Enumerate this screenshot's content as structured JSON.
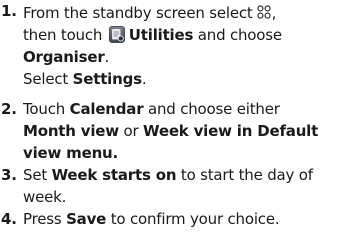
{
  "steps": [
    {
      "num": "1.",
      "p1": "From the standby screen select",
      "p2": ",",
      "p3": "then touch",
      "utilities": "Utilities",
      "p4": "and choose",
      "organiser": "Organiser",
      "p5": ".",
      "p6": "Select",
      "settings": "Settings",
      "p7": ".",
      "icons": [
        "menu-grid-icon",
        "utilities-icon"
      ]
    },
    {
      "num": "2.",
      "p1": "Touch",
      "calendar": "Calendar",
      "p2": "and choose either",
      "month_view": "Month view",
      "p3": "or",
      "week_view": "Week view in Default view menu."
    },
    {
      "num": "3.",
      "p1": "Set",
      "week_starts": "Week starts on",
      "p2": "to start the day of week."
    },
    {
      "num": "4.",
      "p1": "Press",
      "save": "Save",
      "p2": "to confirm your choice."
    }
  ]
}
